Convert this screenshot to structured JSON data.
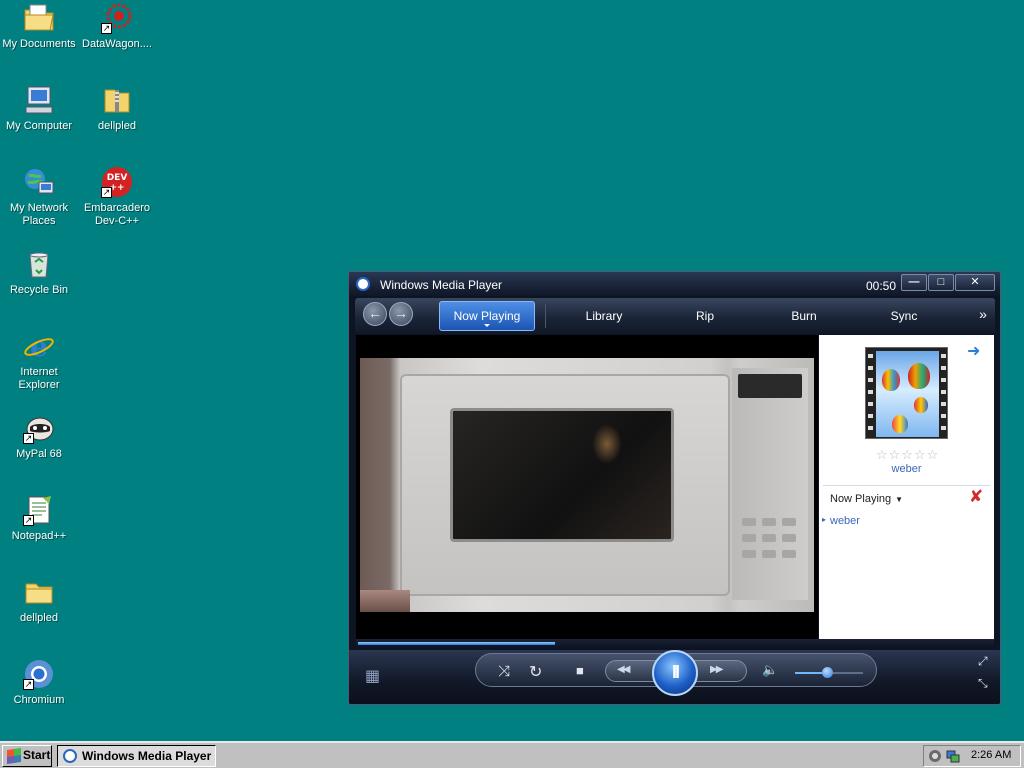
{
  "desktop": {
    "icons": [
      {
        "label": "My Documents",
        "icon": "folder-documents-icon"
      },
      {
        "label": "DataWagon....",
        "icon": "datawagon-gear-icon"
      },
      {
        "label": "My Computer",
        "icon": "computer-icon"
      },
      {
        "label": "dellpled",
        "icon": "zip-folder-icon"
      },
      {
        "label": "My Network Places",
        "icon": "network-places-icon"
      },
      {
        "label": "Embarcadero Dev-C++",
        "icon": "devcpp-icon"
      },
      {
        "label": "Recycle Bin",
        "icon": "recycle-bin-icon"
      },
      {
        "label": "Internet Explorer",
        "icon": "internet-explorer-icon"
      },
      {
        "label": "MyPal 68",
        "icon": "mypal-raccoon-icon"
      },
      {
        "label": "Notepad++",
        "icon": "notepad-plus-plus-icon"
      },
      {
        "label": "dellpled",
        "icon": "folder-icon"
      },
      {
        "label": "Chromium",
        "icon": "chromium-icon"
      }
    ],
    "devcpp_badge": "DEV\n++"
  },
  "wmp": {
    "title": "Windows Media Player",
    "elapsed": "00:50",
    "window_buttons": {
      "minimize": "—",
      "maximize": "□",
      "close": "✕"
    },
    "nav": {
      "back": "←",
      "forward": "→",
      "tabs": [
        "Now Playing",
        "Library",
        "Rip",
        "Burn",
        "Sync"
      ],
      "more": "»"
    },
    "side_pane": {
      "album_name": "weber",
      "rating": "☆☆☆☆☆",
      "playlist_dropdown": "Now Playing",
      "playlist_items": [
        "weber"
      ],
      "clear_icon": "✘",
      "next_arrow": "➜"
    },
    "seek_progress": 0.31,
    "volume_level": 0.47,
    "controls": {
      "shuffle": "⤨",
      "repeat": "↻",
      "stop": "■",
      "prev": "◀◀",
      "play_pause": "II",
      "next": "▶▶",
      "mute": "🔈",
      "fullscreen": "⤢",
      "compact": "⤡",
      "switch_view": "▦"
    }
  },
  "taskbar": {
    "start_label": "Start",
    "task_label": "Windows Media Player",
    "clock": "2:26 AM"
  },
  "colors": {
    "desktop": "#008080",
    "wmp_chrome": "#0d1524",
    "accent": "#1b55b3",
    "link": "#3a68b8"
  }
}
